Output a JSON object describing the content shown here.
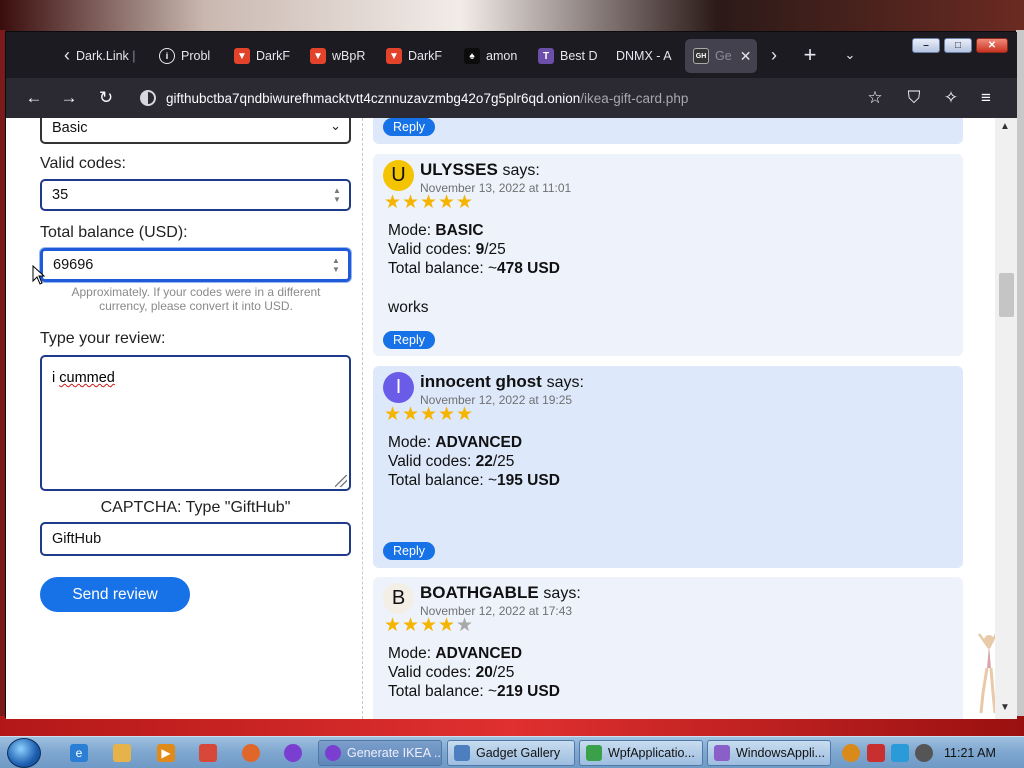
{
  "browser": {
    "tabs": [
      {
        "label": "Dark.Link",
        "icon": "page-icon"
      },
      {
        "label": "Probl",
        "icon": "info-icon"
      },
      {
        "label": "DarkF",
        "icon": "gitlab-icon"
      },
      {
        "label": "wBpR",
        "icon": "gitlab-icon"
      },
      {
        "label": "DarkF",
        "icon": "gitlab-icon"
      },
      {
        "label": "amon",
        "icon": "leaf-icon"
      },
      {
        "label": "Best D",
        "icon": "t-icon"
      },
      {
        "label": "DNMX - A",
        "icon": "page-icon"
      },
      {
        "label": "Ge",
        "icon": "gifthub-icon"
      }
    ],
    "url_host": "gifthubctba7qndbiwurefhmacktvtt4cznnuzavzmbg42o7g5plr6qd.onion",
    "url_path": "/ikea-gift-card.php"
  },
  "form": {
    "mode_value": "Basic",
    "valid_codes_label": "Valid codes:",
    "valid_codes_value": "35",
    "total_balance_label": "Total balance (USD):",
    "total_balance_value": "69696",
    "hint": "Approximately. If your codes were in a different currency, please convert it into USD.",
    "review_label": "Type your review:",
    "review_text_pre": "i ",
    "review_text_misspelled": "cummed",
    "captcha_label": "CAPTCHA: Type \"GiftHub\"",
    "captcha_value": "GiftHub",
    "send_button": "Send review"
  },
  "reviews": {
    "reply_label": "Reply",
    "says": "says:",
    "mode_prefix": "Mode: ",
    "codes_prefix": "Valid codes: ",
    "balance_prefix": "Total balance: ~",
    "items": [
      {
        "initial": "U",
        "avatar_color": "#f5c400",
        "name": "ULYSSES",
        "date": "November 13, 2022 at 11:01",
        "rating": 5,
        "mode": "BASIC",
        "codes": "9",
        "codes_total": "/25",
        "balance": "478 USD",
        "comment": "works"
      },
      {
        "initial": "I",
        "avatar_color": "#6b5ce7",
        "name": "innocent ghost",
        "date": "November 12, 2022 at 19:25",
        "rating": 5,
        "mode": "ADVANCED",
        "codes": "22",
        "codes_total": "/25",
        "balance": "195 USD",
        "comment": ""
      },
      {
        "initial": "B",
        "avatar_color": "#f3efe6",
        "name": "BOATHGABLE",
        "date": "November 12, 2022 at 17:43",
        "rating": 4,
        "mode": "ADVANCED",
        "codes": "20",
        "codes_total": "/25",
        "balance": "219 USD",
        "comment": ""
      }
    ]
  },
  "taskbar": {
    "tasks": [
      "Generate IKEA ...",
      "Gadget Gallery",
      "WpfApplicatio...",
      "WindowsAppli..."
    ],
    "clock": "11:21 AM"
  },
  "colors": {
    "accent": "#1672e6",
    "star": "#f4b400",
    "card": "#dde8fb"
  }
}
